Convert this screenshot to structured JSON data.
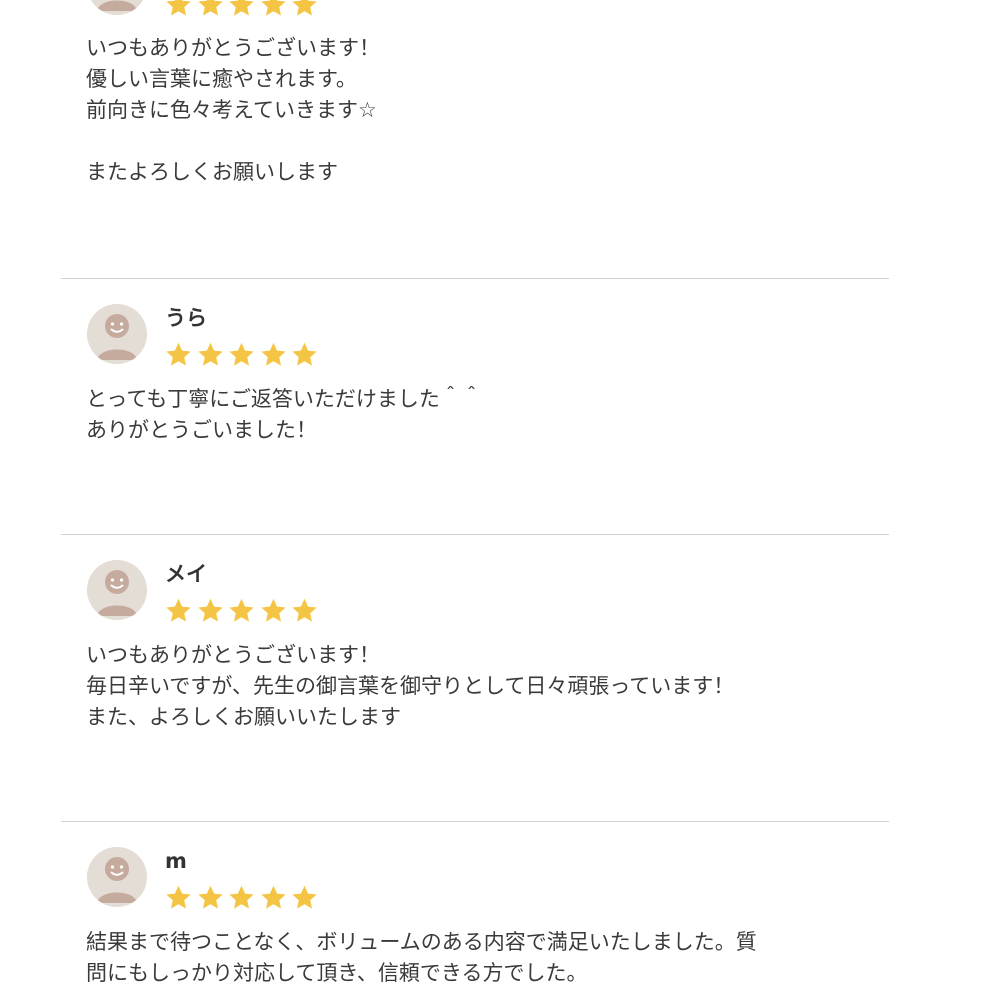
{
  "colors": {
    "star": "#f4c545",
    "avatar_bg": "#e4ddd6",
    "avatar_figure": "#c4ab9e",
    "divider": "#d2d2d2",
    "text": "#3a3a3a"
  },
  "reviews": [
    {
      "name": "",
      "rating": 5,
      "avatar_icon": "user-avatar-icon",
      "lines": [
        "いつもありがとうございます！",
        "優しい言葉に癒やされます。",
        "前向きに色々考えていきます☆",
        "",
        "またよろしくお願いします"
      ]
    },
    {
      "name": "うら",
      "rating": 5,
      "avatar_icon": "user-avatar-icon",
      "lines": [
        "とっても丁寧にご返答いただけました＾＾",
        "ありがとうごいました！"
      ]
    },
    {
      "name": "メイ",
      "rating": 5,
      "avatar_icon": "user-avatar-icon",
      "lines": [
        "いつもありがとうございます！",
        "毎日辛いですが、先生の御言葉を御守りとして日々頑張っています！",
        "また、よろしくお願いいたします"
      ]
    },
    {
      "name": "m",
      "rating": 5,
      "avatar_icon": "user-avatar-icon",
      "lines": [
        "結果まで待つことなく、ボリュームのある内容で満足いたしました。質",
        "問にもしっかり対応して頂き、信頼できる方でした。"
      ]
    }
  ]
}
